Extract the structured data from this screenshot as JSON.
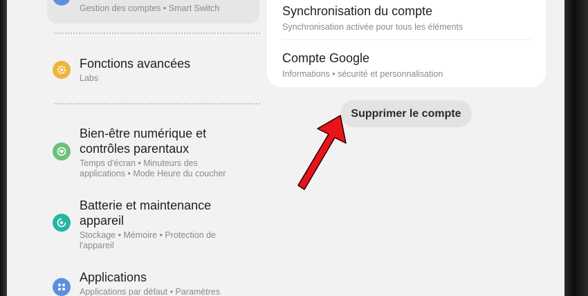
{
  "left_menu": {
    "top_item_sub": "Gestion des comptes  •  Smart Switch",
    "items": [
      {
        "title": "Fonctions avancées",
        "sub": "Labs",
        "icon": "gear-icon",
        "color": "#f0b43c"
      },
      {
        "title": "Bien-être numérique et contrôles parentaux",
        "sub": "Temps d'écran  •  Minuteurs des applications  •  Mode Heure du coucher",
        "icon": "heart-circle-icon",
        "color": "#6cc07a"
      },
      {
        "title": "Batterie et maintenance appareil",
        "sub": "Stockage  •  Mémoire  •  Protection de l'appareil",
        "icon": "battery-care-icon",
        "color": "#26b5a3"
      },
      {
        "title": "Applications",
        "sub": "Applications par défaut  •  Paramètres",
        "icon": "apps-grid-icon",
        "color": "#5d8fe0"
      }
    ]
  },
  "account_panel": {
    "sync": {
      "title": "Synchronisation du compte",
      "sub": "Synchronisation activée pour tous les éléments"
    },
    "google": {
      "title": "Compte Google",
      "sub": "Informations  •  sécurité et personnalisation"
    }
  },
  "delete_button": {
    "label": "Supprimer le compte"
  },
  "annotation": {
    "color": "#e8141a"
  }
}
